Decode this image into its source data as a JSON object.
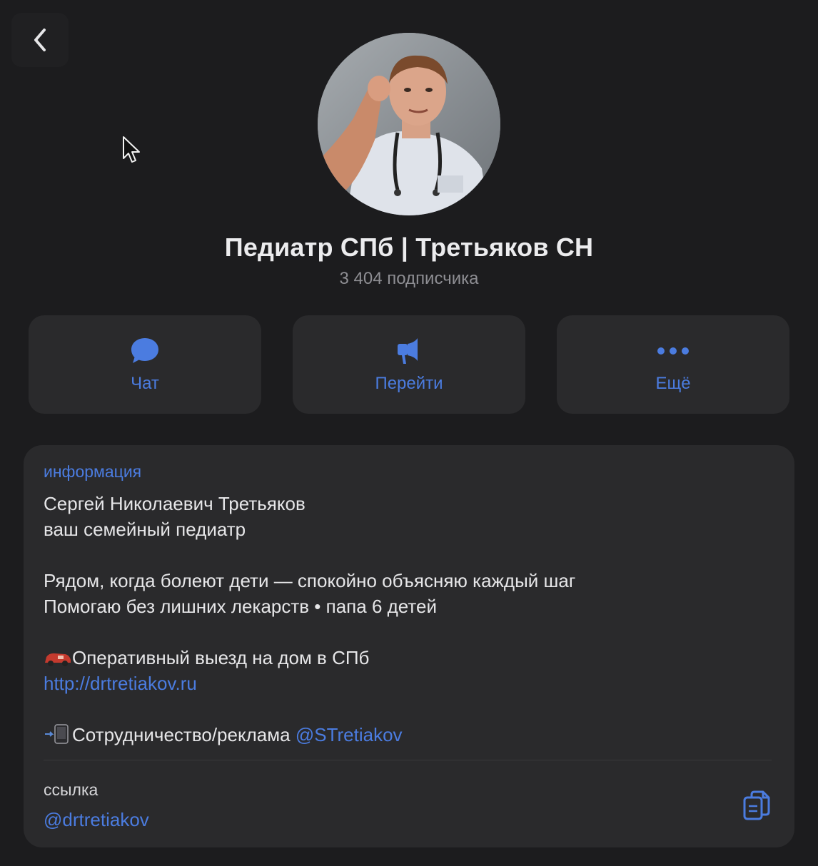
{
  "header": {
    "back_icon": "chevron-left-icon"
  },
  "profile": {
    "title": "Педиатр СПб | Третьяков СН",
    "subscribers": "3 404 подписчика"
  },
  "actions": [
    {
      "label": "Чат",
      "icon": "chat-bubble-icon"
    },
    {
      "label": "Перейти",
      "icon": "megaphone-icon"
    },
    {
      "label": "Ещё",
      "icon": "more-dots-icon"
    }
  ],
  "info": {
    "section_label": "информация",
    "line1": "Сергей Николаевич Третьяков",
    "line2": "ваш семейный педиатр",
    "line3": "Рядом, когда болеют дети — спокойно объясняю каждый шаг",
    "line4": "Помогаю без лишних лекарств • папа 6 детей",
    "line5": "Оперативный выезд на дом в СПб",
    "url": "http://drtretiakov.ru",
    "line6_prefix": "Сотрудничество/реклама",
    "contact_handle": "@STretiakov"
  },
  "link_section": {
    "label": "ссылка",
    "value": "@drtretiakov",
    "copy_icon": "copy-icon"
  },
  "colors": {
    "background": "#1c1c1e",
    "card": "#2a2a2c",
    "accent": "#4b7ce0",
    "secondary_text": "#8e8e93"
  }
}
